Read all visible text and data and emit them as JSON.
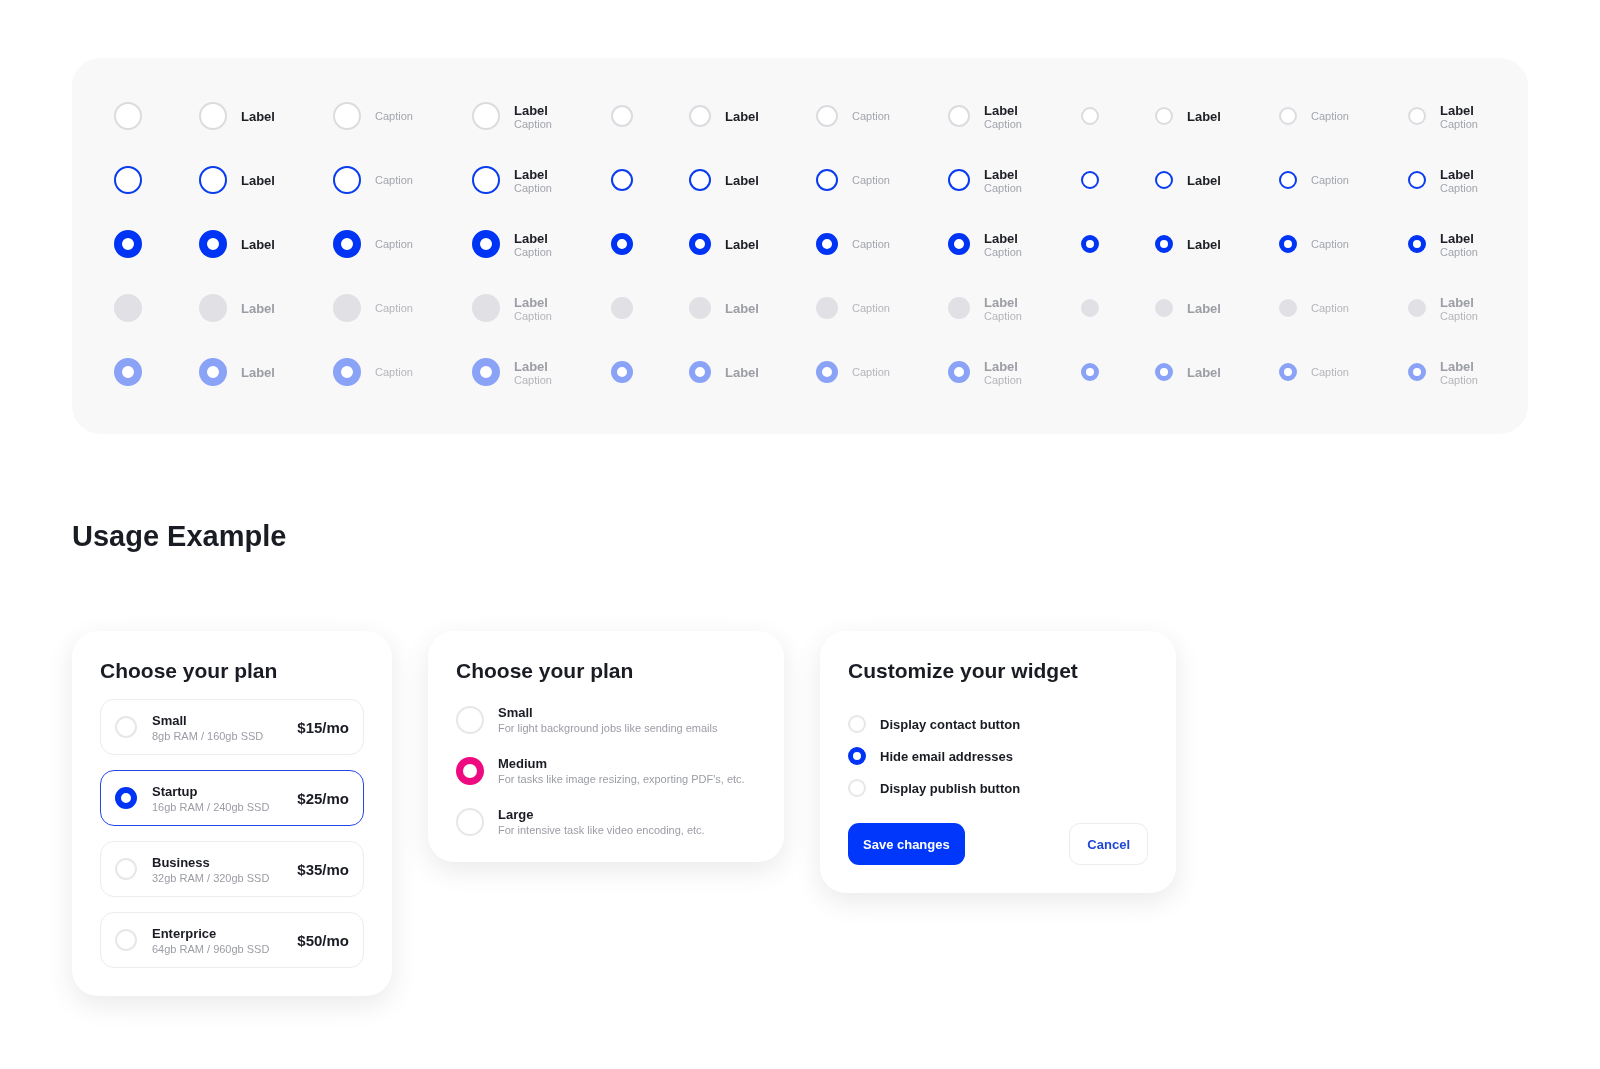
{
  "showcase": {
    "rows": [
      {
        "kind": "normal",
        "selected": false,
        "disabled": false,
        "groups": [
          {
            "kind": "large",
            "cells": [
              {
                "kind": "bare"
              },
              {
                "kind": "label",
                "label": "Label"
              },
              {
                "kind": "caption",
                "caption": "Caption"
              },
              {
                "kind": "both",
                "label": "Label",
                "caption": "Caption"
              }
            ]
          },
          {
            "kind": "medium",
            "cells": [
              {
                "kind": "bare"
              },
              {
                "kind": "label",
                "label": "Label"
              },
              {
                "kind": "caption",
                "caption": "Caption"
              },
              {
                "kind": "both",
                "label": "Label",
                "caption": "Caption"
              }
            ]
          },
          {
            "kind": "small",
            "cells": [
              {
                "kind": "bare"
              },
              {
                "kind": "label",
                "label": "Label"
              },
              {
                "kind": "caption",
                "caption": "Caption"
              },
              {
                "kind": "both",
                "label": "Label",
                "caption": "Caption"
              }
            ]
          }
        ]
      },
      {
        "kind": "hover",
        "selected": false,
        "disabled": false,
        "groups": [
          {
            "kind": "large",
            "cells": [
              {
                "kind": "bare"
              },
              {
                "kind": "label",
                "label": "Label"
              },
              {
                "kind": "caption",
                "caption": "Caption"
              },
              {
                "kind": "both",
                "label": "Label",
                "caption": "Caption"
              }
            ]
          },
          {
            "kind": "medium",
            "cells": [
              {
                "kind": "bare"
              },
              {
                "kind": "label",
                "label": "Label"
              },
              {
                "kind": "caption",
                "caption": "Caption"
              },
              {
                "kind": "both",
                "label": "Label",
                "caption": "Caption"
              }
            ]
          },
          {
            "kind": "small",
            "cells": [
              {
                "kind": "bare"
              },
              {
                "kind": "label",
                "label": "Label"
              },
              {
                "kind": "caption",
                "caption": "Caption"
              },
              {
                "kind": "both",
                "label": "Label",
                "caption": "Caption"
              }
            ]
          }
        ]
      },
      {
        "kind": "normal",
        "selected": true,
        "disabled": false,
        "groups": [
          {
            "kind": "large",
            "cells": [
              {
                "kind": "bare"
              },
              {
                "kind": "label",
                "label": "Label"
              },
              {
                "kind": "caption",
                "caption": "Caption"
              },
              {
                "kind": "both",
                "label": "Label",
                "caption": "Caption"
              }
            ]
          },
          {
            "kind": "medium",
            "cells": [
              {
                "kind": "bare"
              },
              {
                "kind": "label",
                "label": "Label"
              },
              {
                "kind": "caption",
                "caption": "Caption"
              },
              {
                "kind": "both",
                "label": "Label",
                "caption": "Caption"
              }
            ]
          },
          {
            "kind": "small",
            "cells": [
              {
                "kind": "bare"
              },
              {
                "kind": "label",
                "label": "Label"
              },
              {
                "kind": "caption",
                "caption": "Caption"
              },
              {
                "kind": "both",
                "label": "Label",
                "caption": "Caption"
              }
            ]
          }
        ]
      },
      {
        "kind": "normal",
        "selected": false,
        "disabled": true,
        "groups": [
          {
            "kind": "large",
            "cells": [
              {
                "kind": "bare"
              },
              {
                "kind": "label",
                "label": "Label"
              },
              {
                "kind": "caption",
                "caption": "Caption"
              },
              {
                "kind": "both",
                "label": "Label",
                "caption": "Caption"
              }
            ]
          },
          {
            "kind": "medium",
            "cells": [
              {
                "kind": "bare"
              },
              {
                "kind": "label",
                "label": "Label"
              },
              {
                "kind": "caption",
                "caption": "Caption"
              },
              {
                "kind": "both",
                "label": "Label",
                "caption": "Caption"
              }
            ]
          },
          {
            "kind": "small",
            "cells": [
              {
                "kind": "bare"
              },
              {
                "kind": "label",
                "label": "Label"
              },
              {
                "kind": "caption",
                "caption": "Caption"
              },
              {
                "kind": "both",
                "label": "Label",
                "caption": "Caption"
              }
            ]
          }
        ]
      },
      {
        "kind": "normal",
        "selected": true,
        "disabled": true,
        "groups": [
          {
            "kind": "large",
            "cells": [
              {
                "kind": "bare"
              },
              {
                "kind": "label",
                "label": "Label"
              },
              {
                "kind": "caption",
                "caption": "Caption"
              },
              {
                "kind": "both",
                "label": "Label",
                "caption": "Caption"
              }
            ]
          },
          {
            "kind": "medium",
            "cells": [
              {
                "kind": "bare"
              },
              {
                "kind": "label",
                "label": "Label"
              },
              {
                "kind": "caption",
                "caption": "Caption"
              },
              {
                "kind": "both",
                "label": "Label",
                "caption": "Caption"
              }
            ]
          },
          {
            "kind": "small",
            "cells": [
              {
                "kind": "bare"
              },
              {
                "kind": "label",
                "label": "Label"
              },
              {
                "kind": "caption",
                "caption": "Caption"
              },
              {
                "kind": "both",
                "label": "Label",
                "caption": "Caption"
              }
            ]
          }
        ]
      }
    ]
  },
  "usage_heading": "Usage Example",
  "plan_card": {
    "title": "Choose your plan",
    "options": [
      {
        "name": "Small",
        "specs": "8gb RAM / 160gb SSD",
        "price": "$15/mo",
        "selected": false
      },
      {
        "name": "Startup",
        "specs": "16gb RAM / 240gb SSD",
        "price": "$25/mo",
        "selected": true
      },
      {
        "name": "Business",
        "specs": "32gb RAM / 320gb SSD",
        "price": "$35/mo",
        "selected": false
      },
      {
        "name": "Enterprice",
        "specs": "64gb RAM / 960gb SSD",
        "price": "$50/mo",
        "selected": false
      }
    ]
  },
  "plan_list_card": {
    "title": "Choose your plan",
    "options": [
      {
        "name": "Small",
        "description": "For light background jobs like sending emails",
        "selected": false
      },
      {
        "name": "Medium",
        "description": "For tasks like image resizing, exporting PDF's, etc.",
        "selected": true
      },
      {
        "name": "Large",
        "description": "For intensive task like video encoding, etc.",
        "selected": false
      }
    ]
  },
  "widget_card": {
    "title": "Customize your widget",
    "options": [
      {
        "label": "Display contact button",
        "selected": false
      },
      {
        "label": "Hide email addresses",
        "selected": true
      },
      {
        "label": "Display publish button",
        "selected": false
      }
    ],
    "buttons": [
      {
        "label": "Save changes",
        "kind": "primary"
      },
      {
        "label": "Cancel",
        "kind": "secondary"
      }
    ]
  }
}
